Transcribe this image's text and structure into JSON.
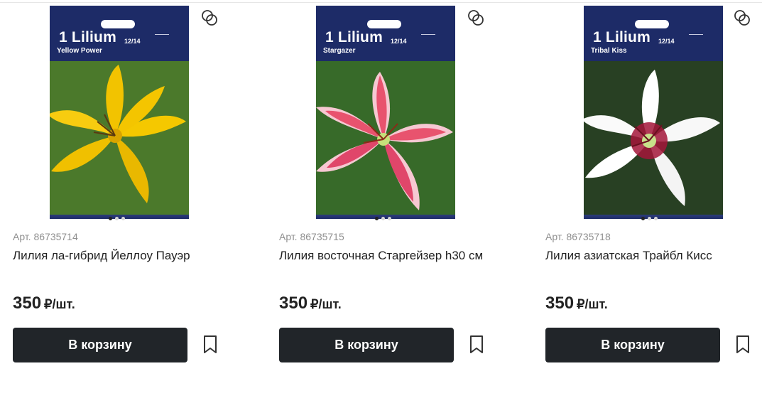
{
  "products": [
    {
      "package_title": "1 Lilium",
      "package_size": "12/14",
      "package_variety": "Yellow Power",
      "sku": "Арт. 86735714",
      "name": "Лилия ла-гибрид Йеллоу Пауэр",
      "price": "350",
      "unit": "₽/шт.",
      "cart_label": "В корзину",
      "flower_color": "#f2c300",
      "bg_color": "#3c6a2a",
      "slides_total": 3,
      "slide_active": 1
    },
    {
      "package_title": "1 Lilium",
      "package_size": "12/14",
      "package_variety": "Stargazer",
      "sku": "Арт. 86735715",
      "name": "Лилия восточная Старгейзер h30 см",
      "price": "350",
      "unit": "₽/шт.",
      "cart_label": "В корзину",
      "flower_color": "#e8536e",
      "bg_color": "#2f5a24",
      "slides_total": 3,
      "slide_active": 1
    },
    {
      "package_title": "1 Lilium",
      "package_size": "12/14",
      "package_variety": "Tribal Kiss",
      "sku": "Арт. 86735718",
      "name": "Лилия азиатская Трайбл Кисс",
      "price": "350",
      "unit": "₽/шт.",
      "cart_label": "В корзину",
      "flower_color": "#ffffff",
      "bg_color": "#263a22",
      "slides_total": 3,
      "slide_active": 1
    }
  ],
  "icons": {
    "compare": "compare-icon",
    "bookmark": "bookmark-icon"
  }
}
